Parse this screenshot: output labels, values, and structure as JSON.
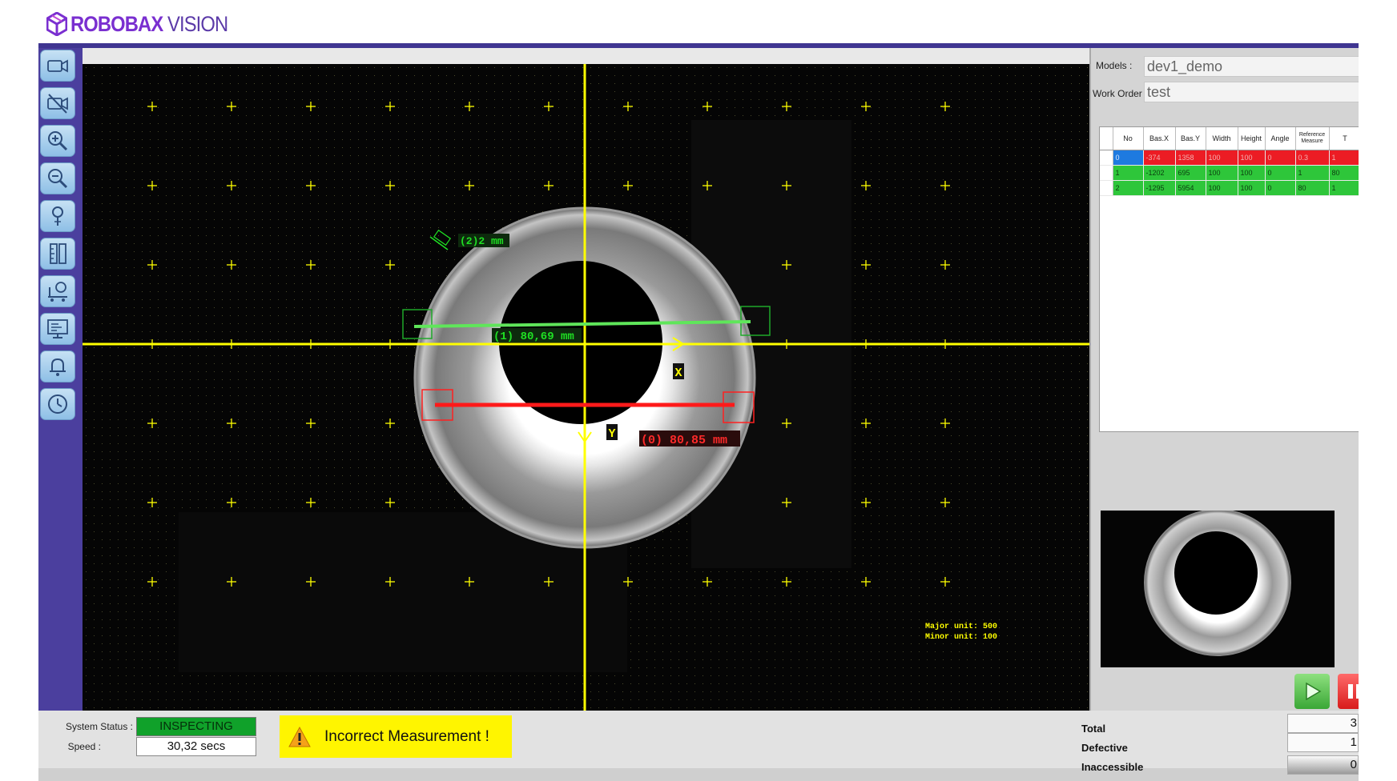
{
  "brand": {
    "name_bold": "ROBOBAX",
    "name_light": "VISION",
    "accent": "#7a2fd0",
    "bar": "#3f3591"
  },
  "toolbar": {
    "buttons": [
      {
        "icon": "camera-icon"
      },
      {
        "icon": "camera-off-icon"
      },
      {
        "icon": "zoom-in-icon"
      },
      {
        "icon": "zoom-out-icon"
      },
      {
        "icon": "probe-icon"
      },
      {
        "icon": "ruler-icon"
      },
      {
        "icon": "conveyor-camera-icon"
      },
      {
        "icon": "monitor-icon"
      },
      {
        "icon": "bell-icon"
      },
      {
        "icon": "clock-icon"
      }
    ]
  },
  "camera": {
    "measurements": [
      {
        "label": "(2)2 mm",
        "color": "#1fe023"
      },
      {
        "label": "(1) 80,69 mm",
        "color": "#1fe023"
      },
      {
        "label": "(0) 80,85 mm",
        "color": "#ff1a1a"
      }
    ],
    "axis_x_label": "X",
    "axis_y_label": "Y",
    "grid_color": "#ffff00",
    "major_unit": "Major unit: 500",
    "minor_unit": "Minor unit: 100"
  },
  "panel": {
    "models_label": "Models :",
    "models_value": "dev1_demo",
    "work_order_label": "Work Order :",
    "work_order_value": "test",
    "table": {
      "columns": [
        "No",
        "Bas.X",
        "Bas.Y",
        "Width",
        "Height",
        "Angle",
        "Reference Measure",
        "T"
      ],
      "rows": [
        {
          "status": "red",
          "cells": [
            "0",
            "-374",
            "1358",
            "100",
            "100",
            "0",
            "0.3",
            "1"
          ]
        },
        {
          "status": "green",
          "cells": [
            "1",
            "-1202",
            "695",
            "100",
            "100",
            "0",
            "1",
            "80"
          ]
        },
        {
          "status": "green",
          "cells": [
            "2",
            "-1295",
            "5954",
            "100",
            "100",
            "0",
            "80",
            "1"
          ]
        }
      ]
    }
  },
  "controls": {
    "play": "play-icon",
    "stop": "stop-icon"
  },
  "status": {
    "system_status_label": "System Status :",
    "system_status_value": "INSPECTING",
    "speed_label": "Speed :",
    "speed_value": "30,32 secs",
    "alert_message": "Incorrect Measurement !",
    "alert_color": "#fff500"
  },
  "counters": {
    "total_label": "Total",
    "total_value": "3",
    "defective_label": "Defective",
    "defective_value": "1",
    "inaccessible_label": "Inaccessible",
    "inaccessible_value": "0"
  }
}
